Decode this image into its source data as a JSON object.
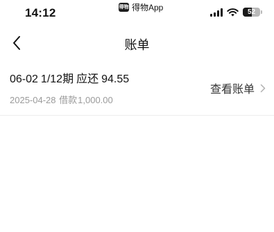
{
  "status_bar": {
    "time": "14:12",
    "app_badge_icon_text": "得物",
    "app_badge_label": "得物App",
    "battery_level": "52",
    "battery_fraction": 0.52,
    "icons": [
      "signal-icon",
      "wifi-icon",
      "battery-icon"
    ]
  },
  "nav": {
    "back_icon": "chevron-left-icon",
    "title": "账单"
  },
  "bill": {
    "due_date": "06-02",
    "installment": "1/12期",
    "due_label": "应还",
    "amount": "94.55",
    "loan_date": "2025-04-28",
    "loan_label": "借款",
    "loan_amount": "1,000.00",
    "view_label": "查看账单",
    "view_icon": "chevron-right-icon"
  },
  "colors": {
    "text_primary": "#111111",
    "text_secondary": "#9a9a9a",
    "divider": "#ededed",
    "background": "#ffffff"
  }
}
